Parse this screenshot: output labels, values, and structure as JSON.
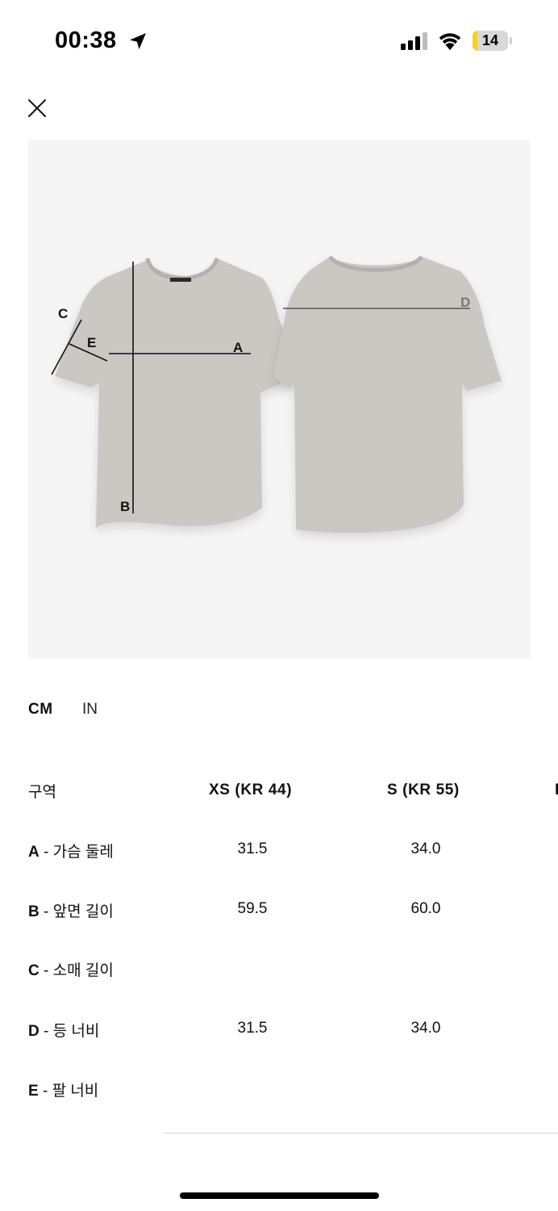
{
  "status_bar": {
    "time": "00:38",
    "battery_level": "14",
    "battery_fraction": 0.14,
    "battery_color": "#f4d21f",
    "icons": [
      "location-arrow-icon",
      "signal-icon",
      "wifi-icon",
      "battery-icon"
    ]
  },
  "header": {
    "close_icon": "close-icon"
  },
  "diagram": {
    "labels": {
      "a": "A",
      "b": "B",
      "c": "C",
      "d": "D",
      "e": "E"
    },
    "garment_color": "#cbc8c4",
    "background_color": "#f5f5f5"
  },
  "units": {
    "active": "CM",
    "inactive": "IN"
  },
  "table": {
    "header": {
      "area": "구역",
      "col1": "XS (KR 44)",
      "col2": "S (KR 55)",
      "col3_partial": "I"
    },
    "rows": [
      {
        "code": "A",
        "label": " - 가슴 둘레",
        "xs": "31.5",
        "s": "34.0"
      },
      {
        "code": "B",
        "label": " - 앞면 길이",
        "xs": "59.5",
        "s": "60.0"
      },
      {
        "code": "C",
        "label": " - 소매 길이",
        "xs": "",
        "s": ""
      },
      {
        "code": "D",
        "label": " - 등 너비",
        "xs": "31.5",
        "s": "34.0"
      },
      {
        "code": "E",
        "label": " - 팔 너비",
        "xs": "",
        "s": ""
      }
    ]
  }
}
